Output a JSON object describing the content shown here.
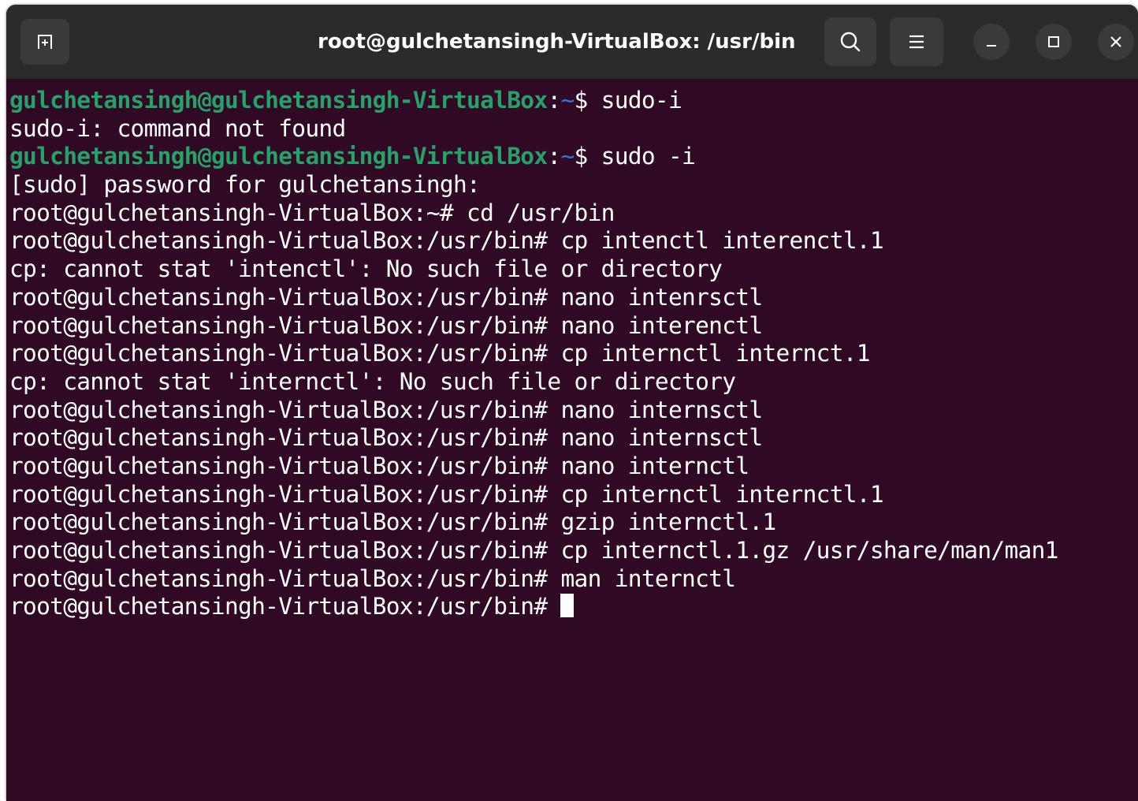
{
  "window": {
    "title": "root@gulchetansingh-VirtualBox: /usr/bin",
    "background_color": "#300a24",
    "titlebar_color": "#2b2b2b"
  },
  "titlebar": {
    "new_tab_icon": "new-tab-icon",
    "search_icon": "search-icon",
    "menu_icon": "hamburger-menu-icon",
    "minimize_icon": "minimize-icon",
    "maximize_icon": "maximize-icon",
    "close_icon": "close-icon"
  },
  "colors": {
    "prompt_user": "#26a269",
    "prompt_path": "#2a7bde",
    "text": "#ffffff"
  },
  "terminal": {
    "lines": [
      {
        "kind": "user",
        "prompt": "gulchetansingh@gulchetansingh-VirtualBox",
        "sep": ":",
        "path": "~",
        "sym": "$ ",
        "cmd": "sudo-i"
      },
      {
        "kind": "out",
        "text": "sudo-i: command not found"
      },
      {
        "kind": "user",
        "prompt": "gulchetansingh@gulchetansingh-VirtualBox",
        "sep": ":",
        "path": "~",
        "sym": "$ ",
        "cmd": "sudo -i"
      },
      {
        "kind": "out",
        "text": "[sudo] password for gulchetansingh:"
      },
      {
        "kind": "out",
        "text": "root@gulchetansingh-VirtualBox:~# cd /usr/bin"
      },
      {
        "kind": "out",
        "text": "root@gulchetansingh-VirtualBox:/usr/bin# cp intenctl interenctl.1"
      },
      {
        "kind": "out",
        "text": "cp: cannot stat 'intenctl': No such file or directory"
      },
      {
        "kind": "out",
        "text": "root@gulchetansingh-VirtualBox:/usr/bin# nano intenrsctl"
      },
      {
        "kind": "out",
        "text": "root@gulchetansingh-VirtualBox:/usr/bin# nano interenctl"
      },
      {
        "kind": "out",
        "text": "root@gulchetansingh-VirtualBox:/usr/bin# cp internctl internct.1"
      },
      {
        "kind": "out",
        "text": "cp: cannot stat 'internctl': No such file or directory"
      },
      {
        "kind": "out",
        "text": "root@gulchetansingh-VirtualBox:/usr/bin# nano internsctl"
      },
      {
        "kind": "out",
        "text": "root@gulchetansingh-VirtualBox:/usr/bin# nano internsctl"
      },
      {
        "kind": "out",
        "text": "root@gulchetansingh-VirtualBox:/usr/bin# nano internctl"
      },
      {
        "kind": "out",
        "text": "root@gulchetansingh-VirtualBox:/usr/bin# cp internctl internctl.1"
      },
      {
        "kind": "out",
        "text": "root@gulchetansingh-VirtualBox:/usr/bin# gzip internctl.1"
      },
      {
        "kind": "out",
        "text": "root@gulchetansingh-VirtualBox:/usr/bin# cp internctl.1.gz /usr/share/man/man1"
      },
      {
        "kind": "out",
        "text": "root@gulchetansingh-VirtualBox:/usr/bin# man internctl"
      },
      {
        "kind": "cursor",
        "text": "root@gulchetansingh-VirtualBox:/usr/bin# "
      }
    ]
  }
}
